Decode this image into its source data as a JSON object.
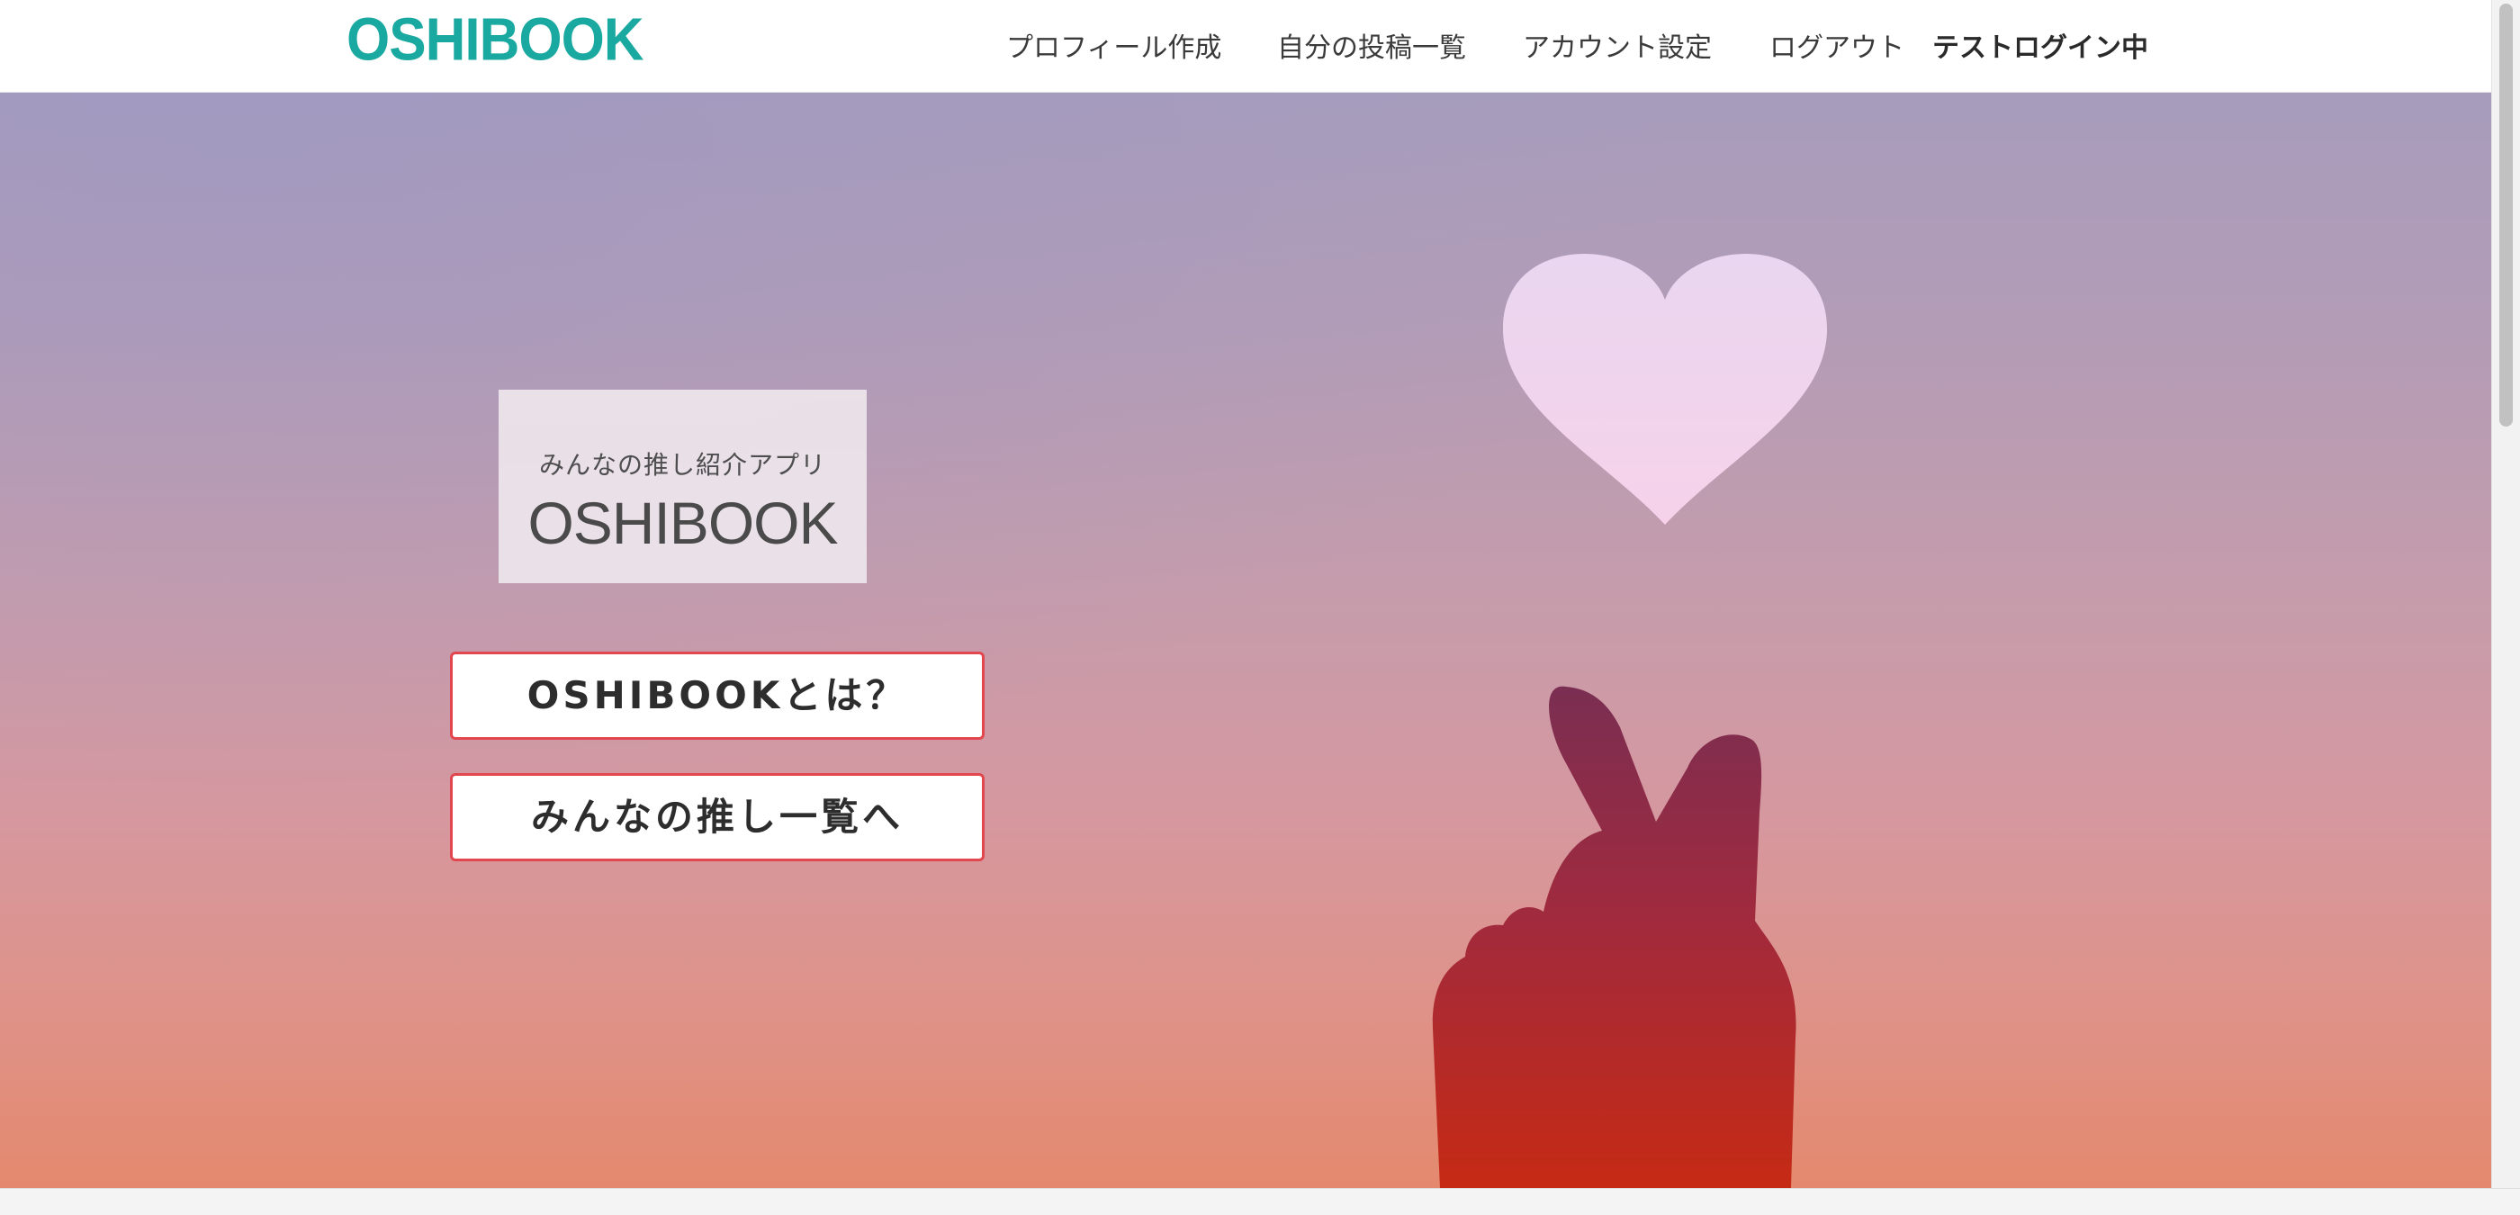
{
  "header": {
    "logo": "OSHIBOOK",
    "nav": [
      {
        "label": "プロフィール作成"
      },
      {
        "label": "自分の投稿一覧"
      },
      {
        "label": "アカウント設定"
      },
      {
        "label": "ログアウト"
      }
    ],
    "status": "テストログイン中"
  },
  "hero": {
    "tagline": "みんなの推し紹介アプリ",
    "title": "OSHIBOOK",
    "buttons": [
      {
        "label": "OSHIBOOKとは？"
      },
      {
        "label": "みんなの推し一覧へ"
      }
    ],
    "image_icons": [
      "heart-icon",
      "finger-heart-hand-icon"
    ]
  },
  "colors": {
    "brand": "#1aa9a0",
    "button_border": "#e2474f",
    "hero_top": "#a79cbc",
    "hero_bottom": "#e4896e",
    "heart": "#f2d8f0",
    "hand": "#c0302a"
  }
}
